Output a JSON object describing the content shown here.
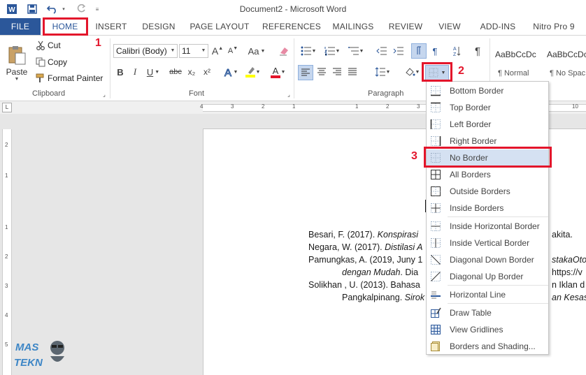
{
  "window": {
    "title": "Document2 - Microsoft Word"
  },
  "quick_access": [
    "word-icon",
    "save-icon",
    "undo-icon",
    "redo-icon",
    "customize-icon"
  ],
  "tabs": [
    "FILE",
    "HOME",
    "INSERT",
    "DESIGN",
    "PAGE LAYOUT",
    "REFERENCES",
    "MAILINGS",
    "REVIEW",
    "VIEW",
    "ADD-INS",
    "Nitro Pro 9"
  ],
  "clipboard": {
    "paste": "Paste",
    "cut": "Cut",
    "copy": "Copy",
    "format_painter": "Format Painter",
    "label": "Clipboard"
  },
  "font": {
    "name": "Calibri (Body)",
    "size": "11",
    "label": "Font",
    "strike": "abc",
    "sub": "x₂",
    "sup": "x²",
    "bold": "B",
    "italic": "I",
    "underline": "U",
    "grow": "A",
    "shrink": "A",
    "case": "Aa"
  },
  "paragraph": {
    "label": "Paragraph"
  },
  "styles": [
    {
      "sample": "AaBbCcDc",
      "name": "¶ Normal"
    },
    {
      "sample": "AaBbCcDc",
      "name": "¶ No Spac..."
    }
  ],
  "ruler": {
    "h_marks": [
      "4",
      "3",
      "2",
      "1",
      "1",
      "2",
      "3",
      "4",
      "5",
      "6",
      "7",
      "8",
      "9",
      "10"
    ],
    "v_marks": [
      "2",
      "1",
      "1",
      "2",
      "3",
      "4",
      "5"
    ]
  },
  "document": {
    "lines": [
      {
        "plain": "Besari, F. (2017). ",
        "italic": "Konspirasi",
        "tail": "akita."
      },
      {
        "plain": "Negara, W. (2017). ",
        "italic": "Distilasi A",
        "tail": ""
      },
      {
        "plain": "Pamungkas, A. (2019, Juny 1",
        "italic": "stakaOto",
        "tail": ""
      },
      {
        "plain": "",
        "italic": "dengan Mudah",
        "tail": ". Dia",
        "tail2": "https://v"
      },
      {
        "plain": "Solikhan , U. (2013). Bahasa",
        "italic": "",
        "tail": "n Iklan d"
      },
      {
        "plain": "Pangkalpinang. ",
        "italic": "Sirok",
        "tail": "",
        "tail2": "an Kesas"
      }
    ]
  },
  "border_menu": {
    "items": [
      {
        "label": "Bottom Border",
        "icon": "bottom-border-icon"
      },
      {
        "label": "Top Border",
        "icon": "top-border-icon"
      },
      {
        "label": "Left Border",
        "icon": "left-border-icon"
      },
      {
        "label": "Right Border",
        "icon": "right-border-icon"
      },
      {
        "label": "No Border",
        "icon": "no-border-icon"
      },
      {
        "label": "All Borders",
        "icon": "all-borders-icon"
      },
      {
        "label": "Outside Borders",
        "icon": "outside-borders-icon"
      },
      {
        "label": "Inside Borders",
        "icon": "inside-borders-icon"
      },
      {
        "label": "Inside Horizontal Border",
        "icon": "inside-horizontal-border-icon"
      },
      {
        "label": "Inside Vertical Border",
        "icon": "inside-vertical-border-icon"
      },
      {
        "label": "Diagonal Down Border",
        "icon": "diagonal-down-border-icon"
      },
      {
        "label": "Diagonal Up Border",
        "icon": "diagonal-up-border-icon"
      },
      {
        "label": "Horizontal Line",
        "icon": "horizontal-line-icon"
      },
      {
        "label": "Draw Table",
        "icon": "draw-table-icon"
      },
      {
        "label": "View Gridlines",
        "icon": "view-gridlines-icon"
      },
      {
        "label": "Borders and Shading...",
        "icon": "borders-shading-icon"
      }
    ]
  },
  "annotations": {
    "step1": "1",
    "step2": "2",
    "step3": "3"
  },
  "watermark": {
    "line1": "MAS",
    "line2": "TEKN"
  },
  "colors": {
    "accent": "#2b579a",
    "highlight_red": "#e3152b",
    "menu_hover": "#d5e1f2"
  }
}
